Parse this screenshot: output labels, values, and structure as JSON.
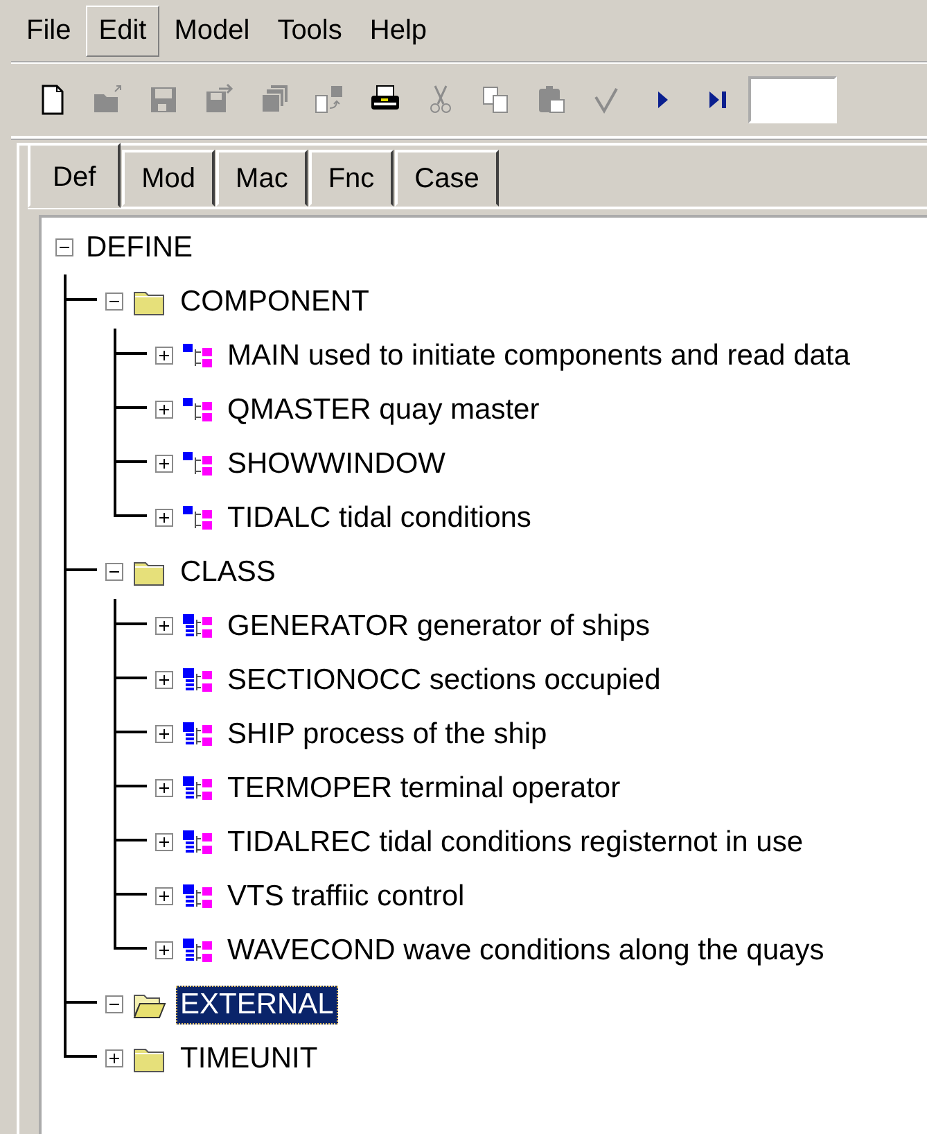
{
  "menu": [
    {
      "label": "File",
      "selected": false
    },
    {
      "label": "Edit",
      "selected": true
    },
    {
      "label": "Model",
      "selected": false
    },
    {
      "label": "Tools",
      "selected": false
    },
    {
      "label": "Help",
      "selected": false
    }
  ],
  "toolbar": [
    {
      "kind": "new",
      "disabled": false
    },
    {
      "kind": "open",
      "disabled": true
    },
    {
      "kind": "save",
      "disabled": true
    },
    {
      "kind": "saveas",
      "disabled": true
    },
    {
      "kind": "saveall",
      "disabled": true
    },
    {
      "kind": "export",
      "disabled": true
    },
    {
      "kind": "print",
      "disabled": false
    },
    {
      "kind": "cut",
      "disabled": true
    },
    {
      "kind": "copy",
      "disabled": true
    },
    {
      "kind": "paste",
      "disabled": true
    },
    {
      "kind": "check",
      "disabled": true
    },
    {
      "kind": "run",
      "disabled": false
    },
    {
      "kind": "step",
      "disabled": false
    }
  ],
  "tabs": [
    {
      "label": "Def",
      "selected": true
    },
    {
      "label": "Mod",
      "selected": false
    },
    {
      "label": "Mac",
      "selected": false
    },
    {
      "label": "Fnc",
      "selected": false
    },
    {
      "label": "Case",
      "selected": false
    }
  ],
  "tree": [
    {
      "label": "DEFINE",
      "expanded": true,
      "selected": false,
      "children": [
        {
          "label": "COMPONENT",
          "kind": "folder",
          "expanded": true,
          "selected": false,
          "children": [
            {
              "label": "MAIN used to initiate components and read data",
              "kind": "component",
              "expanded": false,
              "selected": false
            },
            {
              "label": "QMASTER quay master",
              "kind": "component",
              "expanded": false,
              "selected": false
            },
            {
              "label": "SHOWWINDOW",
              "kind": "component",
              "expanded": false,
              "selected": false
            },
            {
              "label": "TIDALC tidal conditions",
              "kind": "component",
              "expanded": false,
              "selected": false
            }
          ]
        },
        {
          "label": "CLASS",
          "kind": "folder",
          "expanded": true,
          "selected": false,
          "children": [
            {
              "label": "GENERATOR  generator of ships",
              "kind": "class",
              "expanded": false,
              "selected": false
            },
            {
              "label": "SECTIONOCC sections occupied",
              "kind": "class",
              "expanded": false,
              "selected": false
            },
            {
              "label": "SHIP process of the ship",
              "kind": "class",
              "expanded": false,
              "selected": false
            },
            {
              "label": "TERMOPER terminal operator",
              "kind": "class",
              "expanded": false,
              "selected": false
            },
            {
              "label": "TIDALREC tidal conditions registernot in use",
              "kind": "class",
              "expanded": false,
              "selected": false
            },
            {
              "label": "VTS traffiic control",
              "kind": "class",
              "expanded": false,
              "selected": false
            },
            {
              "label": "WAVECOND wave conditions along the quays",
              "kind": "class",
              "expanded": false,
              "selected": false
            }
          ]
        },
        {
          "label": "EXTERNAL",
          "kind": "folder",
          "expanded": true,
          "selected": true
        },
        {
          "label": "TIMEUNIT",
          "kind": "folder",
          "expanded": false,
          "selected": false
        }
      ]
    }
  ]
}
